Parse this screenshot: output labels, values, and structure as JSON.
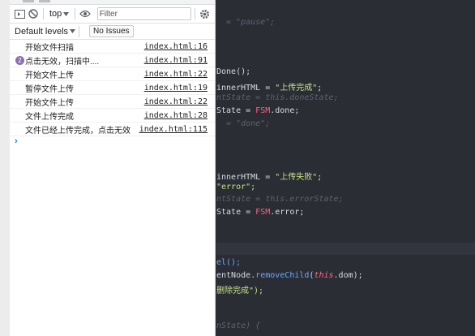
{
  "toolbar": {
    "context_label": "top",
    "filter_placeholder": "Filter",
    "levels_label": "Default levels",
    "issues_label": "No Issues"
  },
  "console": {
    "messages": [
      {
        "text": "开始文件扫描",
        "source": "index.html:16",
        "count": ""
      },
      {
        "text": "点击无效，扫描中....",
        "source": "index.html:91",
        "count": "2"
      },
      {
        "text": "开始文件上传",
        "source": "index.html:22",
        "count": ""
      },
      {
        "text": "暂停文件上传",
        "source": "index.html:19",
        "count": ""
      },
      {
        "text": "开始文件上传",
        "source": "index.html:22",
        "count": ""
      },
      {
        "text": "文件上传完成",
        "source": "index.html:28",
        "count": ""
      },
      {
        "text": "文件已经上传完成，点击无效",
        "source": "index.html:115",
        "count": ""
      }
    ],
    "prompt_symbol": "›"
  },
  "editor": {
    "lines": {
      "l1": "= \"pause\";",
      "l2": "Done();",
      "l3a": "innerHTML = ",
      "l3b": "\"上传完成\"",
      "l3c": ";",
      "l4": "ntState = this.doneState;",
      "l5a": "State = ",
      "l5b": "FSM",
      "l5c": ".done;",
      "l6": "= \"done\";",
      "l7a": "innerHTML = ",
      "l7b": "\"上传失败\"",
      "l7c": ";",
      "l8": "\"error\";",
      "l9": "ntState = this.errorState;",
      "l10a": "State = ",
      "l10b": "FSM",
      "l10c": ".error;",
      "l11": "el();",
      "l12a": "entNode.",
      "l12b": "removeChild",
      "l12c": "(",
      "l12d": "this",
      "l12e": ".dom);",
      "l13": "删除完成\");",
      "l14": "nState) {"
    }
  }
}
